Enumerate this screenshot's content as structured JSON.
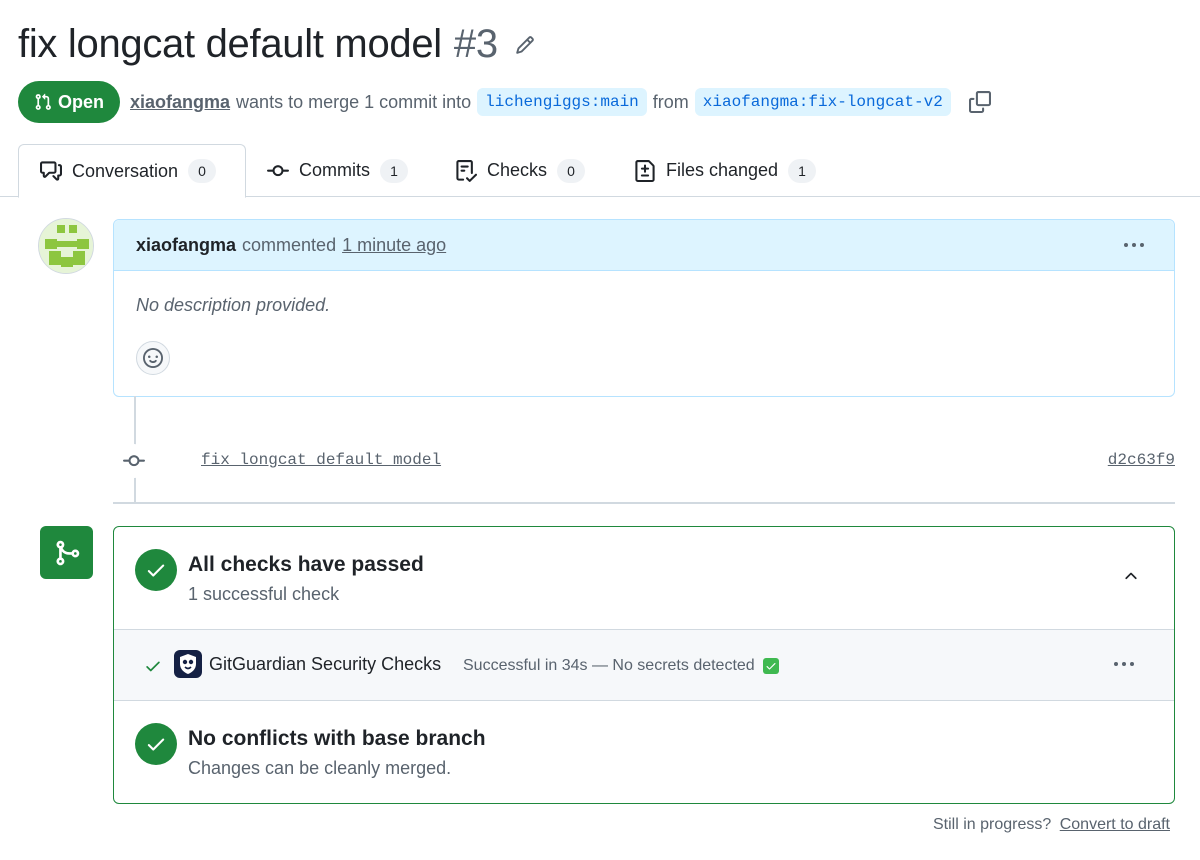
{
  "pr": {
    "title": "fix longcat default model",
    "number": "#3",
    "state": "Open",
    "author": "xiaofangma",
    "merge_text": "wants to merge 1 commit into",
    "base_branch": "lichengiggs:main",
    "from_text": "from",
    "head_branch": "xiaofangma:fix-longcat-v2"
  },
  "tabs": [
    {
      "label": "Conversation",
      "count": "0",
      "icon": "comment-discussion-icon",
      "active": true
    },
    {
      "label": "Commits",
      "count": "1",
      "icon": "git-commit-icon"
    },
    {
      "label": "Checks",
      "count": "0",
      "icon": "checklist-icon"
    },
    {
      "label": "Files changed",
      "count": "1",
      "icon": "file-diff-icon"
    }
  ],
  "comment": {
    "author": "xiaofangma",
    "action": "commented",
    "time": "1 minute ago",
    "body": "No description provided."
  },
  "commit": {
    "message": "fix longcat default model",
    "sha": "d2c63f9"
  },
  "merge": {
    "checks_title": "All checks have passed",
    "checks_sub": "1 successful check",
    "check_name": "GitGuardian Security Checks",
    "check_status": "Successful in 34s — No secrets detected",
    "conflicts_title": "No conflicts with base branch",
    "conflicts_sub": "Changes can be cleanly merged."
  },
  "footer": {
    "question": "Still in progress?",
    "link": "Convert to draft"
  },
  "colors": {
    "green": "#1f883d",
    "link_blue": "#0969da",
    "branch_bg": "#ddf4ff",
    "muted": "#59636e"
  }
}
